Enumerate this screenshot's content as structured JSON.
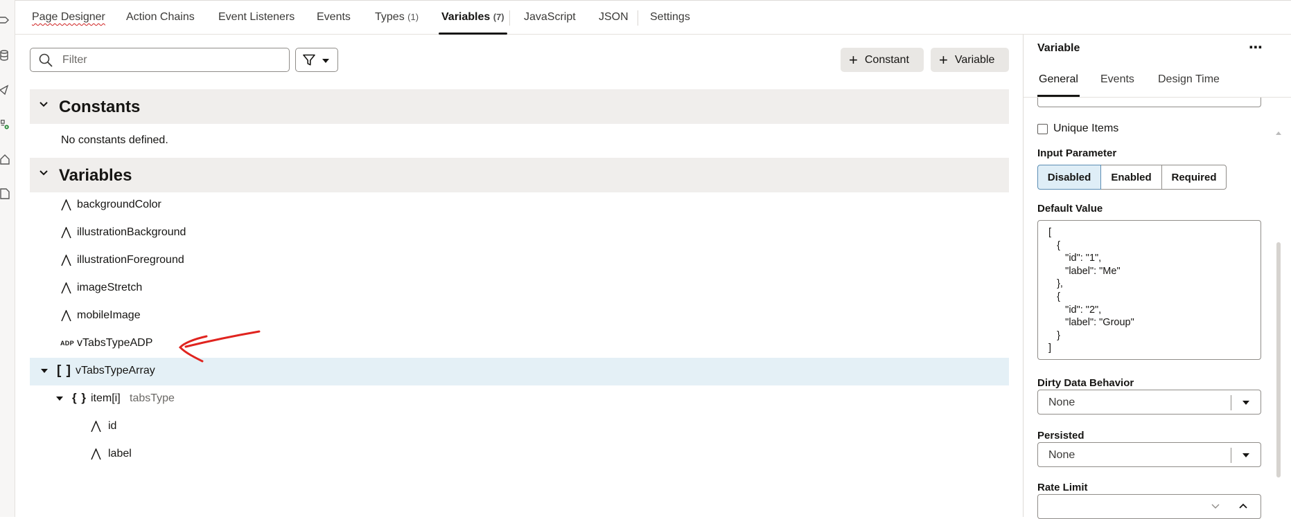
{
  "top_tabs": [
    {
      "label": "Page Designer"
    },
    {
      "label": "Action Chains"
    },
    {
      "label": "Event Listeners"
    },
    {
      "label": "Events"
    },
    {
      "label": "Types",
      "count": "(1)"
    },
    {
      "label": "Variables",
      "count": "(7)"
    },
    {
      "label": "JavaScript"
    },
    {
      "label": "JSON"
    },
    {
      "label": "Settings"
    }
  ],
  "active_tab": "Variables",
  "filter": {
    "placeholder": "Filter",
    "value": ""
  },
  "buttons": {
    "constant": "Constant",
    "variable": "Variable"
  },
  "constants_section": {
    "title": "Constants",
    "empty_text": "No constants defined."
  },
  "variables_section": {
    "title": "Variables",
    "items": [
      {
        "name": "backgroundColor",
        "icon": "string-type-icon"
      },
      {
        "name": "illustrationBackground",
        "icon": "string-type-icon"
      },
      {
        "name": "illustrationForeground",
        "icon": "string-type-icon"
      },
      {
        "name": "imageStretch",
        "icon": "string-type-icon"
      },
      {
        "name": "mobileImage",
        "icon": "string-type-icon"
      },
      {
        "name": "vTabsTypeADP",
        "icon": "adp-type-icon",
        "icon_text": "ADP"
      },
      {
        "name": "vTabsTypeArray",
        "icon": "array-type-icon",
        "icon_text": "[ ]",
        "selected": true,
        "expanded": true
      },
      {
        "name": "item[i]",
        "type_hint": "tabsType",
        "icon": "object-type-icon",
        "icon_text": "{ }",
        "expanded": true
      },
      {
        "name": "id",
        "icon": "string-type-icon"
      },
      {
        "name": "label",
        "icon": "string-type-icon"
      }
    ]
  },
  "properties_panel": {
    "title": "Variable",
    "tabs": [
      "General",
      "Events",
      "Design Time"
    ],
    "active_tab": "General",
    "unique_items_label": "Unique Items",
    "unique_items_checked": false,
    "input_parameter": {
      "label": "Input Parameter",
      "options": [
        "Disabled",
        "Enabled",
        "Required"
      ],
      "selected": "Disabled"
    },
    "default_value": {
      "label": "Default Value",
      "text": "[\n   {\n      \"id\": \"1\",\n      \"label\": \"Me\"\n   },\n   {\n      \"id\": \"2\",\n      \"label\": \"Group\"\n   }\n]"
    },
    "dirty_data_behavior": {
      "label": "Dirty Data Behavior",
      "value": "None"
    },
    "persisted": {
      "label": "Persisted",
      "value": "None"
    },
    "rate_limit": {
      "label": "Rate Limit",
      "value": ""
    }
  },
  "annotation": {
    "color": "#e0241f"
  }
}
